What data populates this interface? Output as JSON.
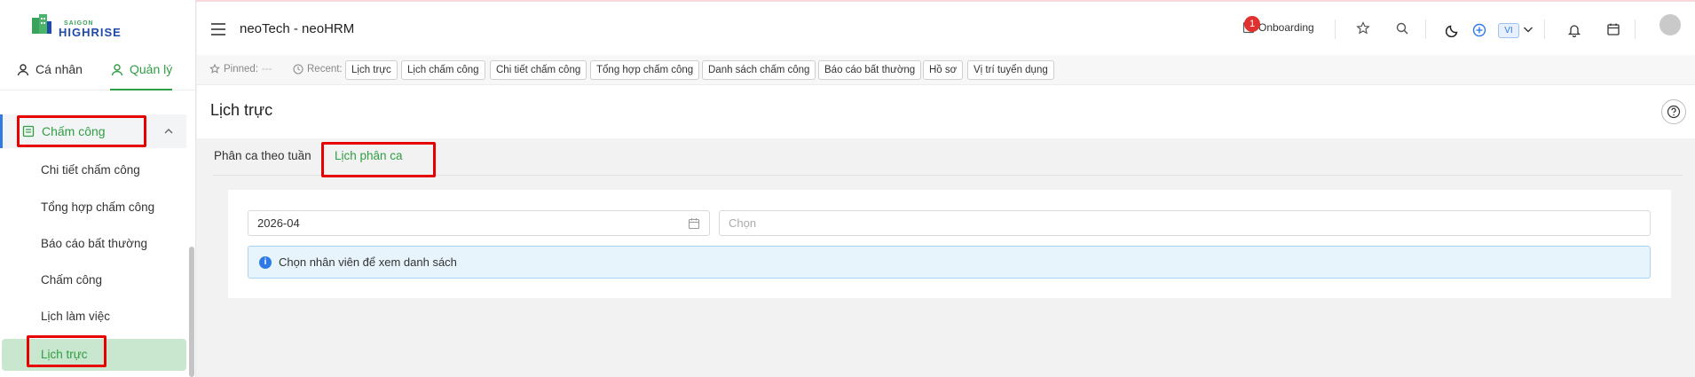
{
  "logo": {
    "small": "SAIGON",
    "big": "HIGHRISE"
  },
  "user_tabs": [
    {
      "label": "Cá nhân",
      "icon": "user-icon",
      "active": false
    },
    {
      "label": "Quản lý",
      "icon": "manager-icon",
      "active": true
    }
  ],
  "sidebar": {
    "parent": {
      "label": "Chấm công",
      "icon": "timesheet-icon"
    },
    "items": [
      {
        "label": "Chi tiết chấm công"
      },
      {
        "label": "Tổng hợp chấm công"
      },
      {
        "label": "Báo cáo bất thường"
      },
      {
        "label": "Chấm công"
      },
      {
        "label": "Lịch làm việc"
      },
      {
        "label": "Lịch trực",
        "active": true
      }
    ]
  },
  "header": {
    "title": "neoTech - neoHRM",
    "notification_count": "1",
    "onboarding_label": "Onboarding",
    "language": "VI"
  },
  "pinbar": {
    "pinned_label": "Pinned:",
    "pinned_empty": "---",
    "recent_label": "Recent:",
    "recent": [
      "Lịch trực",
      "Lịch chấm công",
      "Chi tiết chấm công",
      "Tổng hợp chấm công",
      "Danh sách chấm công",
      "Báo cáo bất thường",
      "Hồ sơ",
      "Vị trí tuyển dụng"
    ]
  },
  "page": {
    "title": "Lịch trực",
    "tabs": [
      {
        "label": "Phân ca theo tuần",
        "active": false
      },
      {
        "label": "Lịch phân ca",
        "active": true
      }
    ],
    "month_value": "2026-04",
    "employee_placeholder": "Chọn",
    "alert": "Chọn nhân viên để xem danh sách"
  },
  "colors": {
    "accent": "#2f9e44",
    "info": "#2f7ae5",
    "badge": "#e03131",
    "highlight": "#e60000"
  }
}
